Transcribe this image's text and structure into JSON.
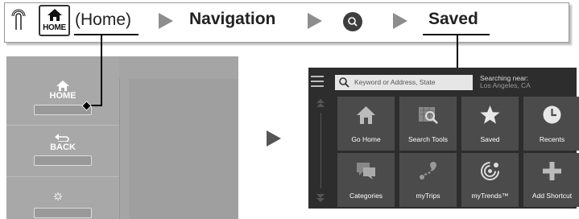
{
  "instruction": {
    "home_button_text": "HOME",
    "home_label": "(Home)",
    "step_navigation": "Navigation",
    "step_saved": "Saved"
  },
  "side_panel": {
    "home_label": "HOME",
    "back_label": "BACK"
  },
  "nav_screen": {
    "search_placeholder": "Keyword or Address, State",
    "searching_near_title": "Searching near:",
    "searching_near_location": "Los Angeles, CA",
    "tiles": [
      {
        "label": "Go Home",
        "icon": "house-icon"
      },
      {
        "label": "Search Tools",
        "icon": "map-search-icon"
      },
      {
        "label": "Saved",
        "icon": "star-icon"
      },
      {
        "label": "Recents",
        "icon": "clock-icon"
      },
      {
        "label": "Categories",
        "icon": "speech-bubbles-icon"
      },
      {
        "label": "myTrips",
        "icon": "route-pins-icon"
      },
      {
        "label": "myTrends™",
        "icon": "radar-icon"
      },
      {
        "label": "Add Shortcut",
        "icon": "plus-icon"
      }
    ]
  },
  "colors": {
    "screen_bg": "#2d2d2d",
    "tile_bg": "#4b4b4b",
    "panel_gray": "#a5a5a5",
    "arrow_gray": "#8d8d8d"
  }
}
